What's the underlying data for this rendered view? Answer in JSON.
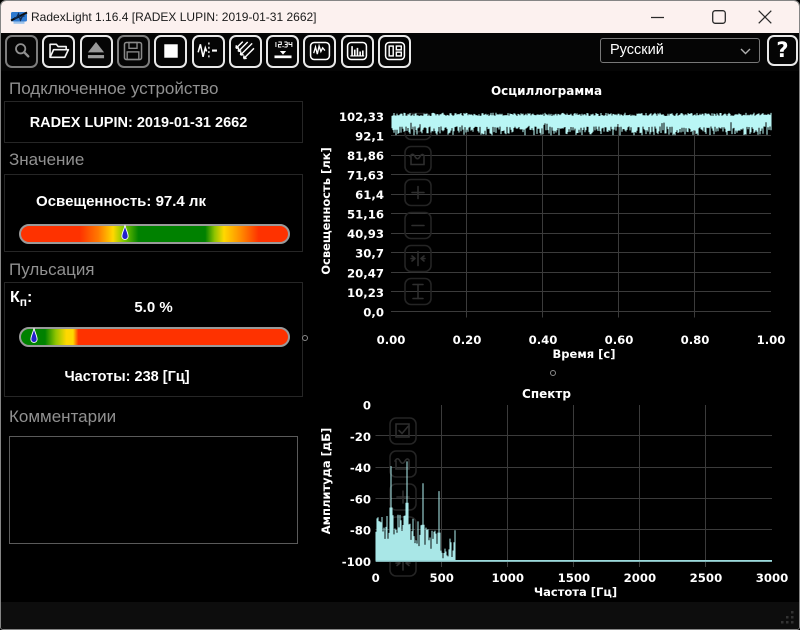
{
  "window": {
    "title": "RadexLight 1.16.4 [RADEX LUPIN: 2019-01-31 2662]"
  },
  "toolbar": {
    "language_value": "Русский",
    "help_label": "?"
  },
  "device_panel": {
    "heading": "Подключенное устройство",
    "device": "RADEX LUPIN: 2019-01-31 2662"
  },
  "value_panel": {
    "heading": "Значение",
    "reading": "Освещенность: 97.4 лк",
    "marker_frac": 0.39
  },
  "pulsation_panel": {
    "heading": "Пульсация",
    "kp_label": "К",
    "kp_sub": "п",
    "kp_colon": ":",
    "kp_value": "5.0 %",
    "marker_frac": 0.048,
    "freq": "Частоты: 238 [Гц]"
  },
  "comments_panel": {
    "heading": "Комментарии",
    "text": ""
  },
  "chart_data": [
    {
      "type": "line",
      "title": "Осциллограмма",
      "xlabel": "Время [с]",
      "ylabel": "Освещенность [лк]",
      "xlim": [
        0,
        1
      ],
      "ylim": [
        0,
        102.33
      ],
      "xticks": [
        "0.00",
        "0.20",
        "0.40",
        "0.60",
        "0.80",
        "1.00"
      ],
      "yticks": [
        "102,33",
        "92,1",
        "81,86",
        "71,63",
        "61,4",
        "51,16",
        "40,93",
        "30,7",
        "20,47",
        "10,23",
        "0,0"
      ],
      "signal": {
        "mean_lux": 97.4,
        "band_min_lux": 92,
        "band_max_lux": 102.33,
        "description": "dense noise band at top of scale"
      }
    },
    {
      "type": "area",
      "title": "Спектр",
      "xlabel": "Частота [Гц]",
      "ylabel": "Амплитуда [дБ]",
      "xlim": [
        0,
        3000
      ],
      "ylim": [
        -100,
        0
      ],
      "xticks": [
        "0",
        "500",
        "1000",
        "1500",
        "2000",
        "2500",
        "3000"
      ],
      "yticks": [
        "0",
        "-20",
        "-40",
        "-60",
        "-80",
        "-100"
      ],
      "noise_band_hz": [
        0,
        610
      ],
      "noise_floor_db": [
        -88,
        -72
      ],
      "peaks": [
        [
          119,
          -39
        ],
        [
          238,
          -36
        ],
        [
          357,
          -50
        ],
        [
          476,
          -55
        ],
        [
          604,
          -80
        ]
      ],
      "baseline_db": -100
    }
  ]
}
